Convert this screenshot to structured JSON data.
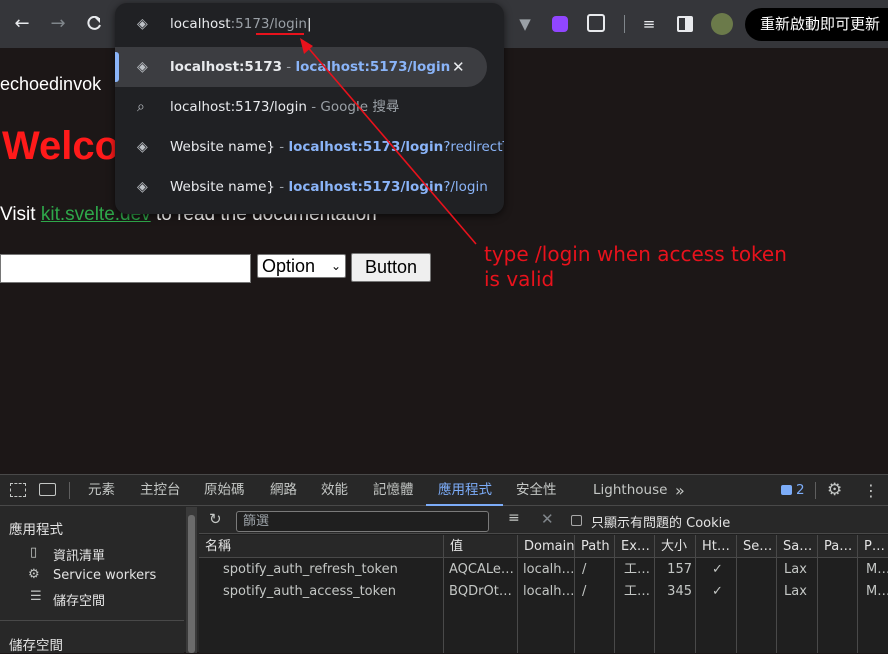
{
  "omnibox": {
    "input": {
      "host": "localhost",
      "rest": ":5173/login"
    },
    "suggestions": [
      {
        "title": "localhost:5173",
        "sep": " - ",
        "url": "localhost:5173/login",
        "suffix": "",
        "icon": "globe-icon",
        "selected": true
      },
      {
        "title": "localhost:5173/login",
        "sep": " - ",
        "url": "",
        "suffix": "Google 搜尋",
        "icon": "search-icon",
        "selected": false
      },
      {
        "title": "Website name}",
        "sep": " - ",
        "url": "localhost:5173/login",
        "suffix": "?redirectT…",
        "icon": "globe-icon",
        "selected": false
      },
      {
        "title": "Website name}",
        "sep": " - ",
        "url": "localhost:5173/login",
        "suffix": "?/login",
        "icon": "globe-icon",
        "selected": false
      }
    ],
    "remove_glyph": "✕"
  },
  "toolbar": {
    "relaunch_label": "重新啟動即可更新"
  },
  "page": {
    "site_name": "echoedinvok",
    "welcome": "Welco",
    "visit_prefix": "Visit ",
    "visit_link": "kit.svelte.dev",
    "visit_suffix": " to read the documentation",
    "select_value": "Option",
    "button_label": "Button"
  },
  "annotation": {
    "line1": "type /login when access token",
    "line2": "is valid"
  },
  "devtools": {
    "tabs": [
      "元素",
      "主控台",
      "原始碼",
      "網路",
      "效能",
      "記憶體",
      "應用程式",
      "安全性",
      "Lighthouse"
    ],
    "active_tab": "應用程式",
    "issues_count": "2",
    "filter_placeholder": "篩選",
    "cookie_checkbox_label": "只顯示有問題的 Cookie",
    "sidebar": {
      "app_heading": "應用程式",
      "items": [
        "資訊清單",
        "Service workers",
        "儲存空間"
      ],
      "storage_heading": "儲存空間"
    },
    "columns": [
      "名稱",
      "值",
      "Domain",
      "Path",
      "Ex…",
      "大小",
      "Ht…",
      "Se…",
      "Sa…",
      "Pa…",
      "P…"
    ],
    "rows": [
      [
        "spotify_auth_refresh_token",
        "AQCALe…",
        "localh…",
        "/",
        "工…",
        "157",
        "✓",
        "",
        "Lax",
        "",
        "M…"
      ],
      [
        "spotify_auth_access_token",
        "BQDrOt…",
        "localh…",
        "/",
        "工…",
        "345",
        "✓",
        "",
        "Lax",
        "",
        "M…"
      ]
    ]
  },
  "colors": {
    "annotation": "#e8121c",
    "welcome": "#ff1a1a",
    "link": "#2ea84a",
    "accent_blue": "#8ab4f8"
  }
}
